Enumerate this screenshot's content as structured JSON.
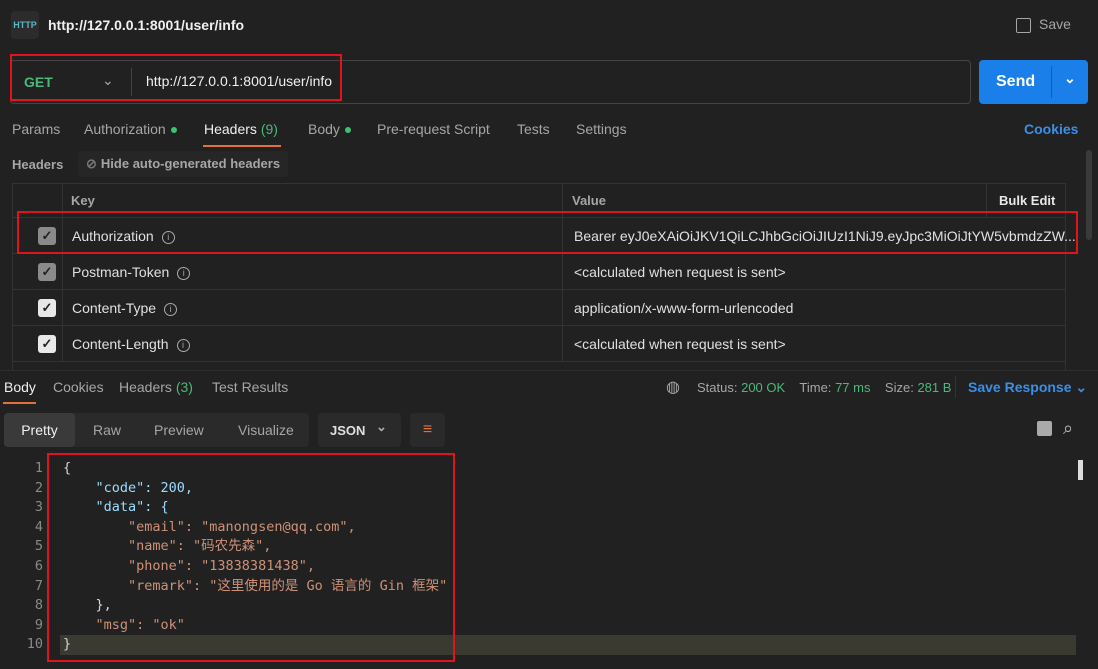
{
  "header": {
    "icon": "http-icon",
    "title": "http://127.0.0.1:8001/user/info",
    "save_label": "Save"
  },
  "request": {
    "method": "GET",
    "url": "http://127.0.0.1:8001/user/info",
    "send_label": "Send"
  },
  "request_tabs": [
    {
      "label": "Params"
    },
    {
      "label": "Authorization",
      "dot": true
    },
    {
      "label": "Headers",
      "count": "(9)",
      "active": true
    },
    {
      "label": "Body",
      "dot": true
    },
    {
      "label": "Pre-request Script"
    },
    {
      "label": "Tests"
    },
    {
      "label": "Settings"
    }
  ],
  "cookies_label": "Cookies",
  "headers_section": {
    "label": "Headers",
    "hide_label": "Hide auto-generated headers"
  },
  "headers_table": {
    "columns": {
      "key": "Key",
      "value": "Value",
      "bulk_edit": "Bulk Edit"
    },
    "rows": [
      {
        "checked": true,
        "dim": true,
        "key": "Authorization",
        "value": "Bearer eyJ0eXAiOiJKV1QiLCJhbGciOiJIUzI1NiJ9.eyJpc3MiOiJtYW5vbmdzZW..."
      },
      {
        "checked": true,
        "dim": true,
        "key": "Postman-Token",
        "value": "<calculated when request is sent>"
      },
      {
        "checked": true,
        "dim": false,
        "key": "Content-Type",
        "value": "application/x-www-form-urlencoded"
      },
      {
        "checked": true,
        "dim": false,
        "key": "Content-Length",
        "value": "<calculated when request is sent>"
      }
    ]
  },
  "response": {
    "tabs": [
      {
        "label": "Body",
        "active": true
      },
      {
        "label": "Cookies"
      },
      {
        "label": "Headers",
        "count": "(3)"
      },
      {
        "label": "Test Results"
      }
    ],
    "status_label": "Status:",
    "status": "200 OK",
    "time_label": "Time:",
    "time": "77 ms",
    "size_label": "Size:",
    "size": "281 B",
    "save_response": "Save Response",
    "view_tabs": [
      "Pretty",
      "Raw",
      "Preview",
      "Visualize"
    ],
    "active_view": "Pretty",
    "format": "JSON",
    "body_lines": [
      "{",
      "    \"code\": 200,",
      "    \"data\": {",
      "        \"email\": \"manongsen@qq.com\",",
      "        \"name\": \"码农先森\",",
      "        \"phone\": \"13838381438\",",
      "        \"remark\": \"这里使用的是 Go 语言的 Gin 框架\"",
      "    },",
      "    \"msg\": \"ok\"",
      "}"
    ]
  },
  "colors": {
    "accent": "#1a7fe8",
    "green": "#4bb87a",
    "highlight": "#e0141e",
    "tab_underline": "#e3703a"
  }
}
